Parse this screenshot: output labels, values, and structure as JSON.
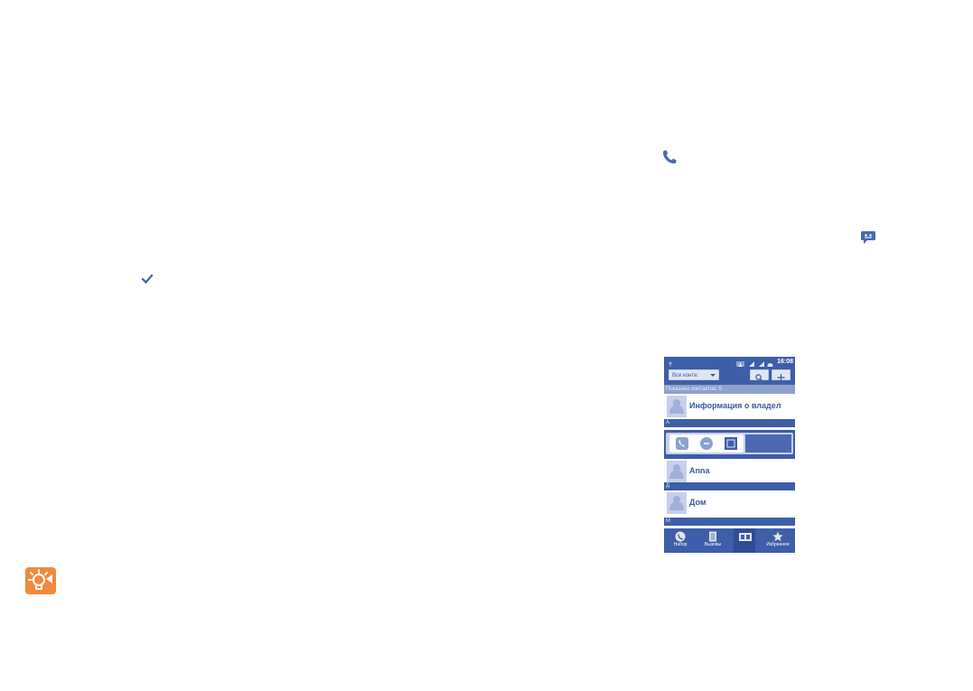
{
  "icons": {
    "check": "check-icon",
    "phone": "phone-icon",
    "sms": "sms-icon",
    "tip": "lightbulb-tip-icon"
  },
  "colors": {
    "brand_blue": "#3f5ea8",
    "tip_orange": "#f08a3c"
  },
  "phone_screen": {
    "status_time": "16:08",
    "account_filter": "Все конта:",
    "contacts_count": "Показано контактов: 5",
    "contacts": [
      {
        "name": "Информация о владел"
      },
      {
        "name": "Anna"
      },
      {
        "name": "Дом"
      }
    ],
    "section_letters": [
      "A",
      "Д",
      "M"
    ],
    "bottom_nav": [
      {
        "label": "Набор",
        "icon": "dialer-icon"
      },
      {
        "label": "Вызовы",
        "icon": "call-log-icon"
      },
      {
        "label": "",
        "icon": "contacts-icon"
      },
      {
        "label": "Избранное",
        "icon": "star-icon"
      }
    ]
  }
}
